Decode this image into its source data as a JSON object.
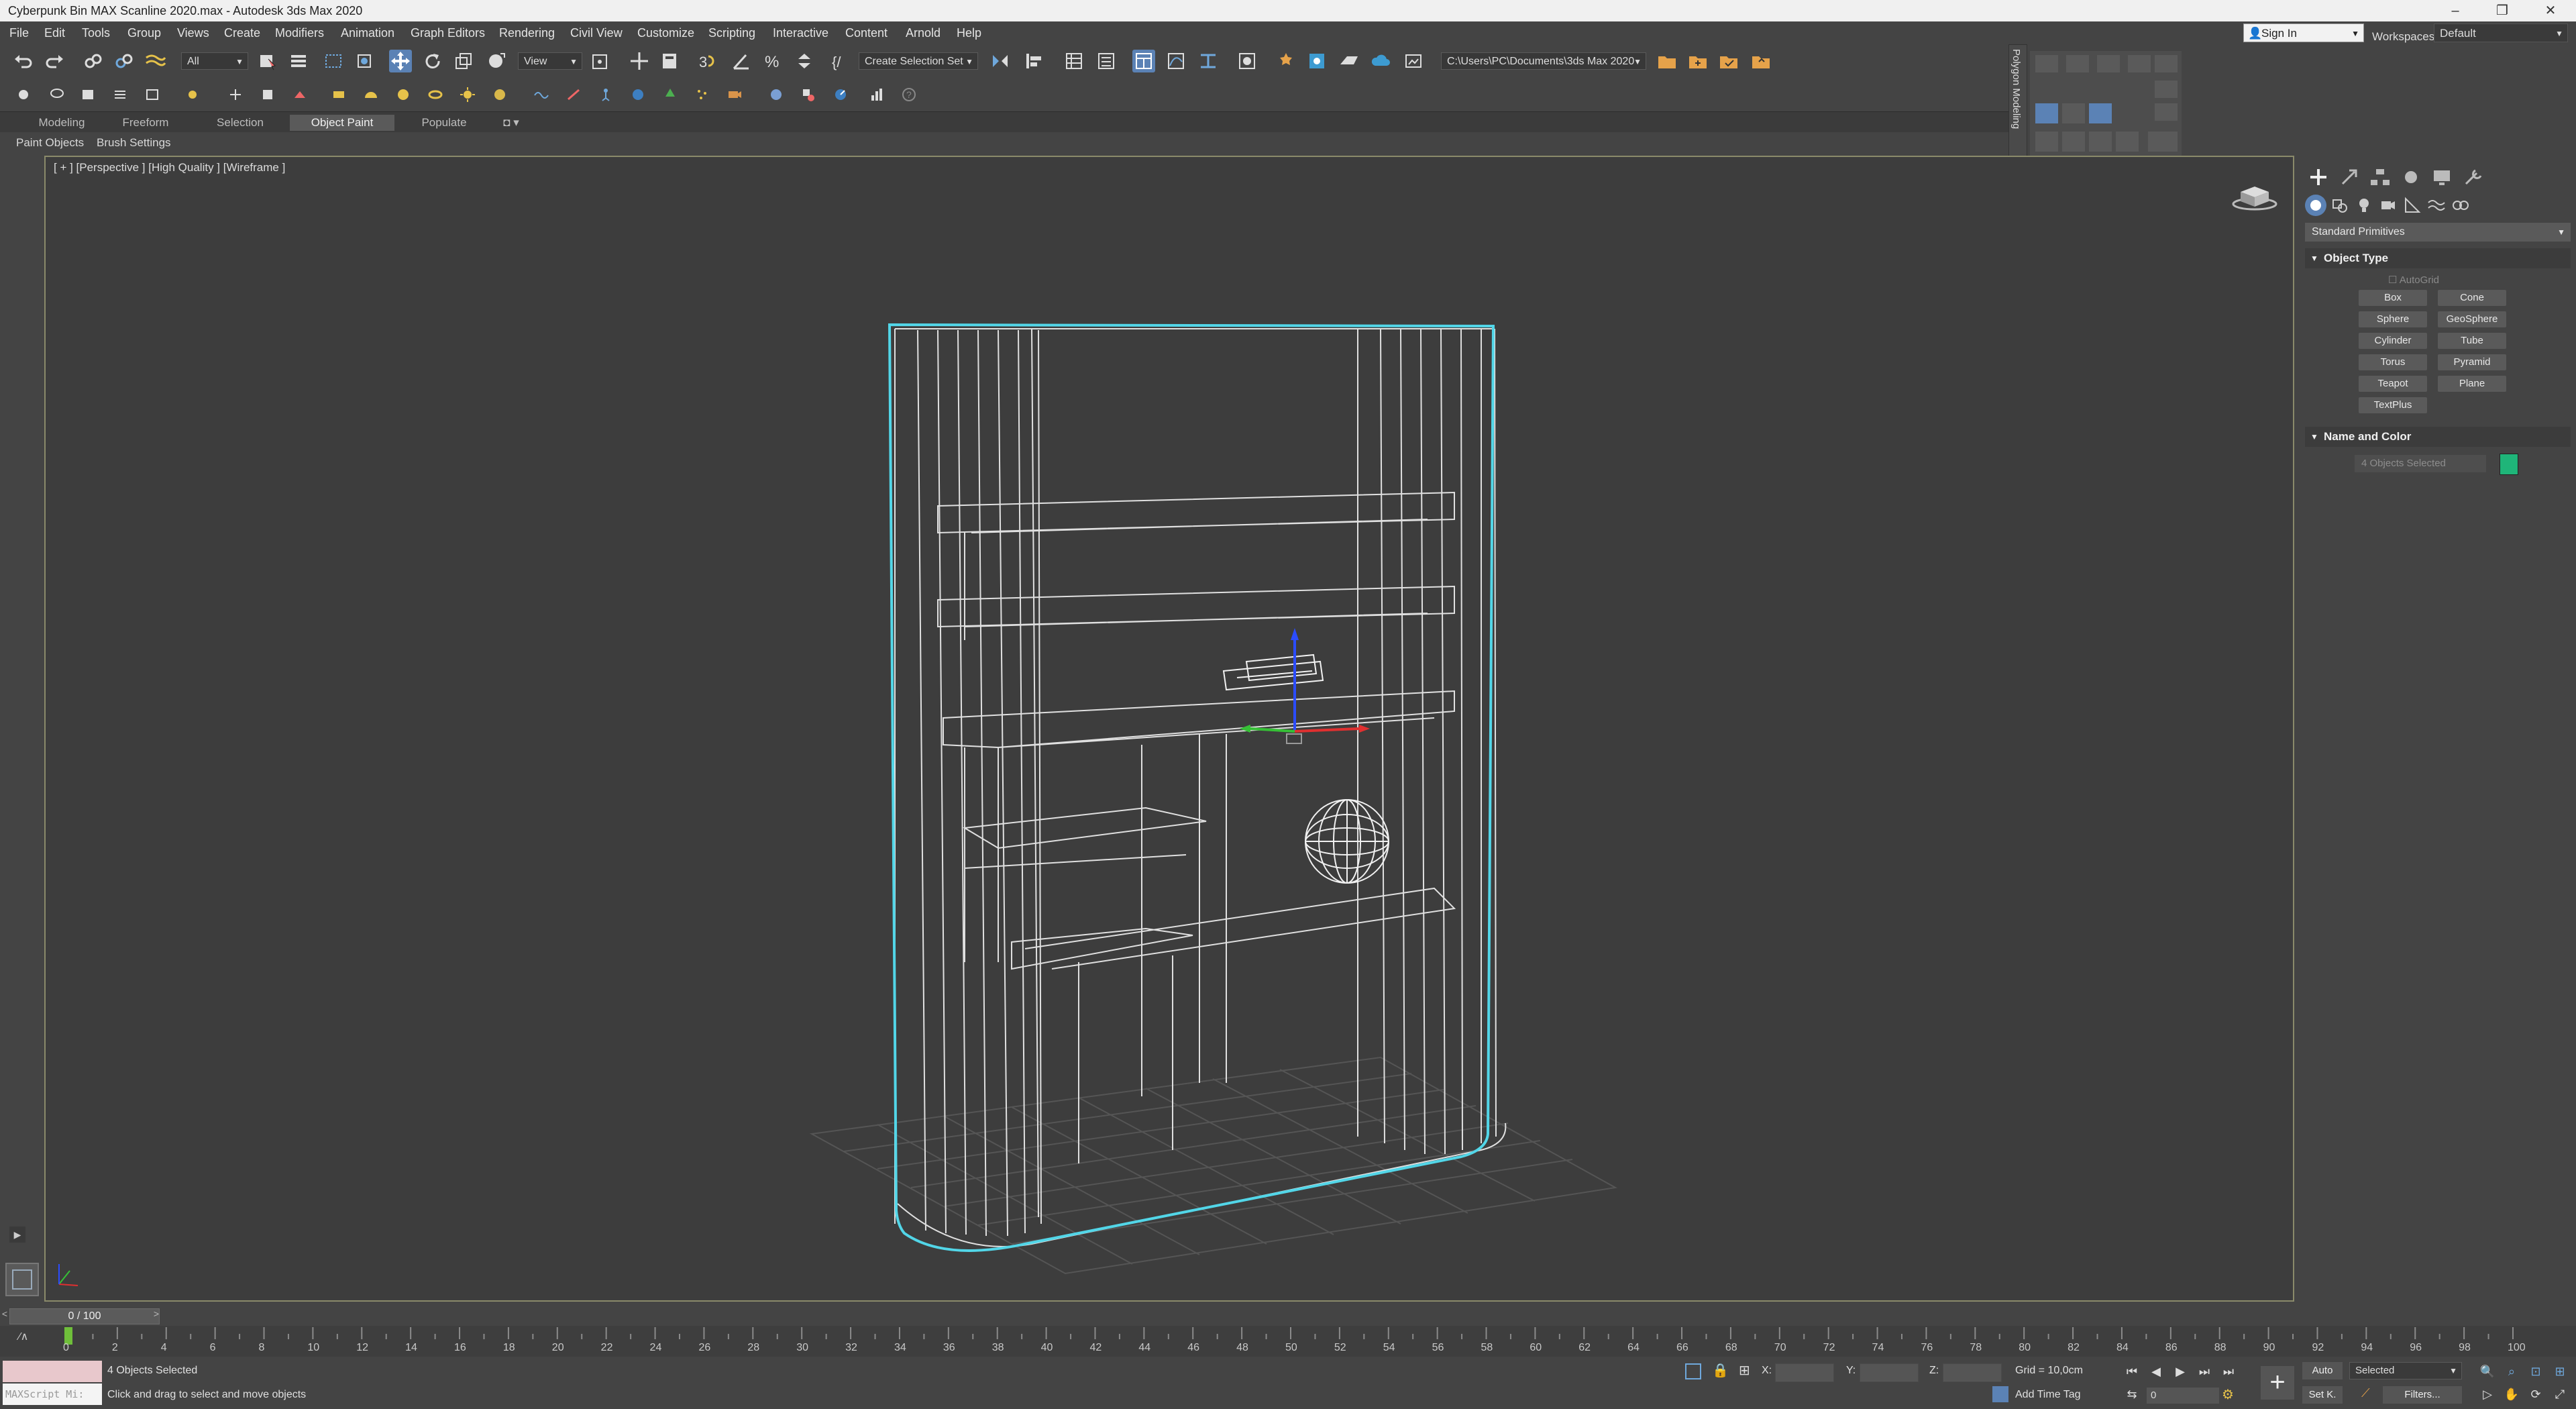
{
  "window": {
    "title": "Cyberpunk Bin MAX Scanline 2020.max - Autodesk 3ds Max 2020",
    "minimize": "–",
    "restore": "❐",
    "close": "✕"
  },
  "menubar": {
    "items": [
      "File",
      "Edit",
      "Tools",
      "Group",
      "Views",
      "Create",
      "Modifiers",
      "Animation",
      "Graph Editors",
      "Rendering",
      "Civil View",
      "Customize",
      "Scripting",
      "Interactive",
      "Content",
      "Arnold",
      "Help"
    ],
    "sign_in": "Sign In",
    "workspaces_label": "Workspaces:",
    "workspace_value": "Default"
  },
  "toolbar": {
    "selection_filter": "All",
    "ref_coord": "View",
    "selection_set": "Create Selection Set",
    "project_path": "C:\\Users\\PC\\Documents\\3ds Max 2020"
  },
  "ribbon": {
    "tabs": [
      "Modeling",
      "Freeform",
      "Selection",
      "Object Paint",
      "Populate"
    ],
    "active_tab": "Object Paint",
    "sub_items": [
      "Paint Objects",
      "Brush Settings"
    ],
    "side_label": "Polygon Modeling"
  },
  "viewport": {
    "label": "[ + ] [Perspective ] [High Quality ] [Wireframe ]"
  },
  "command_panel": {
    "category": "Standard Primitives",
    "object_type_title": "Object Type",
    "autogrid": "AutoGrid",
    "primitives": [
      "Box",
      "Cone",
      "Sphere",
      "GeoSphere",
      "Cylinder",
      "Tube",
      "Torus",
      "Pyramid",
      "Teapot",
      "Plane",
      "TextPlus"
    ],
    "name_color_title": "Name and Color",
    "object_name": "4 Objects Selected",
    "object_color": "#1fb579"
  },
  "timeline": {
    "frame_display": "0 / 100",
    "ticks": [
      "0",
      "2",
      "4",
      "6",
      "8",
      "10",
      "12",
      "14",
      "16",
      "18",
      "20",
      "22",
      "24",
      "26",
      "28",
      "30",
      "32",
      "34",
      "36",
      "38",
      "40",
      "42",
      "44",
      "46",
      "48",
      "50",
      "52",
      "54",
      "56",
      "58",
      "60",
      "62",
      "64",
      "66",
      "68",
      "70",
      "72",
      "74",
      "76",
      "78",
      "80",
      "82",
      "84",
      "86",
      "88",
      "90",
      "92",
      "94",
      "96",
      "98",
      "100"
    ]
  },
  "status": {
    "maxscript": "MAXScript Mi:",
    "selection": "4 Objects Selected",
    "prompt": "Click and drag to select and move objects",
    "x_label": "X:",
    "y_label": "Y:",
    "z_label": "Z:",
    "grid": "Grid = 10,0cm",
    "add_time_tag": "Add Time Tag",
    "auto": "Auto",
    "set_key": "Set K.",
    "key_filter": "Selected",
    "filters": "Filters...",
    "frame_spinner": "0"
  }
}
